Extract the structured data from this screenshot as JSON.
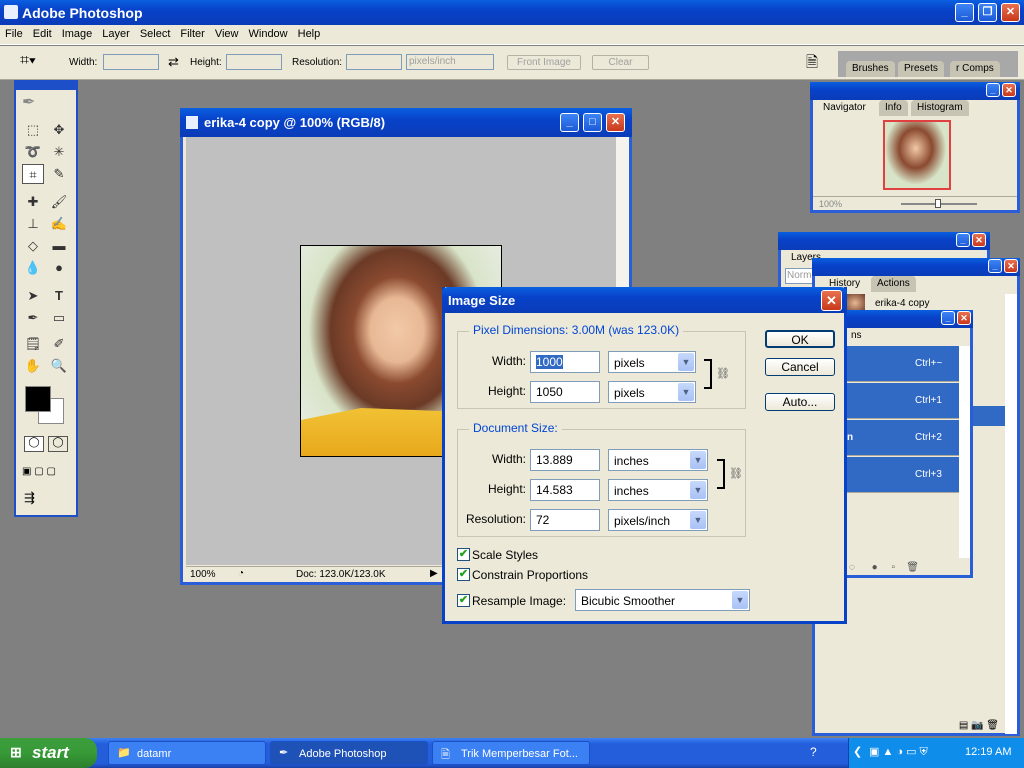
{
  "app": {
    "title": "Adobe Photoshop"
  },
  "menu": [
    "File",
    "Edit",
    "Image",
    "Layer",
    "Select",
    "Filter",
    "View",
    "Window",
    "Help"
  ],
  "options": {
    "width_label": "Width:",
    "height_label": "Height:",
    "resolution_label": "Resolution:",
    "units": "pixels/inch",
    "front_image": "Front Image",
    "clear": "Clear"
  },
  "palette_well": {
    "tabs": [
      "Brushes",
      "Presets",
      "r Comps"
    ]
  },
  "document": {
    "title": "erika-4 copy @ 100% (RGB/8)",
    "zoom": "100%",
    "doc_info": "Doc: 123.0K/123.0K"
  },
  "navigator": {
    "tabs": [
      "Navigator",
      "Info",
      "Histogram"
    ],
    "zoom": "100%"
  },
  "layers": {
    "tab": "Layers",
    "blend": "Norm"
  },
  "history": {
    "tabs": [
      "History",
      "Actions"
    ],
    "snapshot": "erika-4 copy"
  },
  "actions": {
    "tab_partial": "ns",
    "rows": [
      {
        "name": "",
        "shortcut": "Ctrl+~"
      },
      {
        "name": "",
        "shortcut": "Ctrl+1"
      },
      {
        "name": "n",
        "shortcut": "Ctrl+2"
      },
      {
        "name": "",
        "shortcut": "Ctrl+3"
      }
    ]
  },
  "dialog": {
    "title": "Image Size",
    "pixel_dimensions": {
      "title": "Pixel Dimensions:  3.00M (was 123.0K)",
      "width_label": "Width:",
      "width": "1000",
      "width_unit": "pixels",
      "height_label": "Height:",
      "height": "1050",
      "height_unit": "pixels"
    },
    "document_size": {
      "title": "Document Size:",
      "width_label": "Width:",
      "width": "13.889",
      "width_unit": "inches",
      "height_label": "Height:",
      "height": "14.583",
      "height_unit": "inches",
      "resolution_label": "Resolution:",
      "resolution": "72",
      "resolution_unit": "pixels/inch"
    },
    "scale_styles": {
      "label": "Scale Styles",
      "checked": true
    },
    "constrain": {
      "label": "Constrain Proportions",
      "checked": true
    },
    "resample": {
      "label": "Resample Image:",
      "checked": true,
      "method": "Bicubic Smoother"
    },
    "ok": "OK",
    "cancel": "Cancel",
    "auto": "Auto..."
  },
  "taskbar": {
    "start": "start",
    "tasks": [
      "datamr",
      "Adobe Photoshop",
      "Trik Memperbesar Fot..."
    ],
    "clock": "12:19 AM"
  }
}
